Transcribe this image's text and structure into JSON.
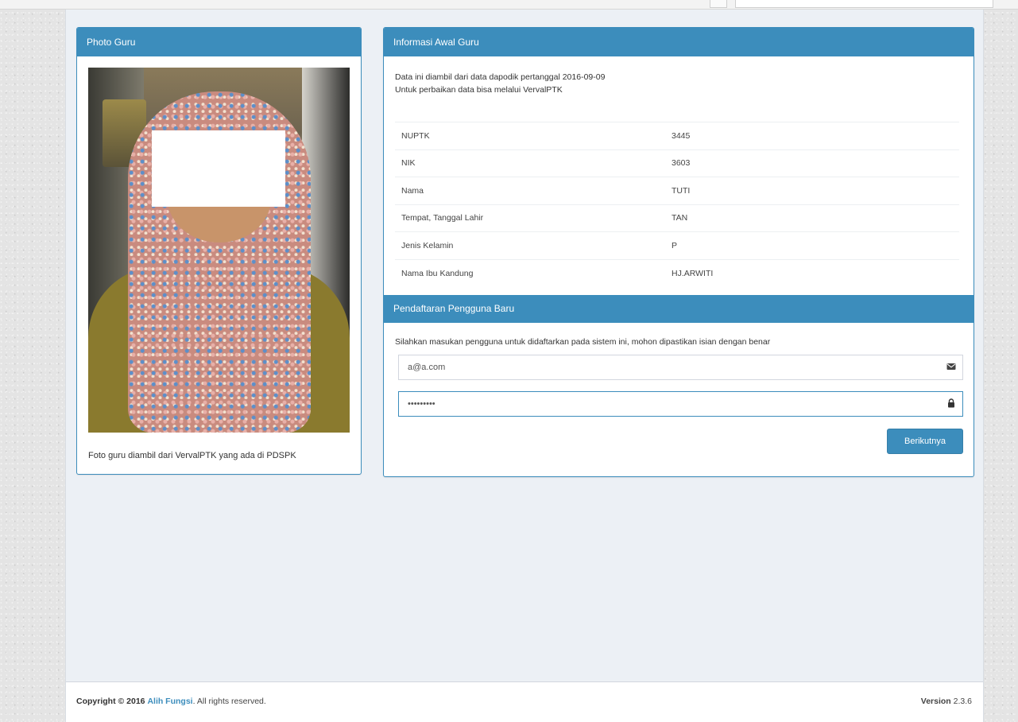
{
  "photo_box": {
    "title": "Photo Guru",
    "caption": "Foto guru diambil dari VervalPTK yang ada di PDSPK"
  },
  "info_box": {
    "title": "Informasi Awal Guru",
    "intro_line1": "Data ini diambil dari data dapodik pertanggal 2016-09-09",
    "intro_line2": "Untuk perbaikan data bisa melalui VervalPTK",
    "rows": [
      {
        "label": "NUPTK",
        "value": "3445"
      },
      {
        "label": "NIK",
        "value": "3603"
      },
      {
        "label": "Nama",
        "value": "TUTI"
      },
      {
        "label": "Tempat, Tanggal Lahir",
        "value": "TAN"
      },
      {
        "label": "Jenis Kelamin",
        "value": "P"
      },
      {
        "label": "Nama Ibu Kandung",
        "value": "HJ.ARWITI"
      }
    ]
  },
  "registration": {
    "title": "Pendaftaran Pengguna Baru",
    "instruction": "Silahkan masukan pengguna untuk didaftarkan pada sistem ini, mohon dipastikan isian dengan benar",
    "email_value": "a@a.com",
    "password_value": "•••••••••",
    "next_button": "Berikutnya"
  },
  "footer": {
    "copyright_prefix": "Copyright © 2016",
    "brand": "Alih Fungsi",
    "suffix": ". All rights reserved.",
    "version_label": "Version",
    "version_value": "2.3.6"
  }
}
